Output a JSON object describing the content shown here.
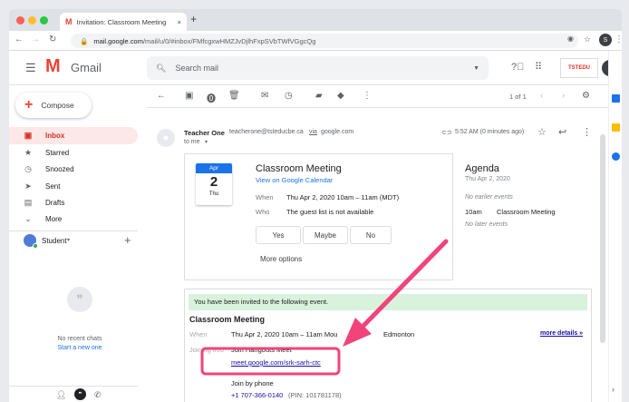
{
  "browser": {
    "tab_title": "Invitation: Classroom Meeting",
    "tab_close": "×",
    "new_tab": "+",
    "url_host": "mail.google.com",
    "url_path": "/mail/u/0/#inbox/FMfcgxwHMZJvDjlhFxpSVbTWfVGgcQg",
    "profile_initial": "S"
  },
  "gmail": {
    "logo_text": "Gmail",
    "search_placeholder": "Search mail",
    "account_initial": "S",
    "org_logo_text": "TSTEDU"
  },
  "sidebar": {
    "compose_label": "Compose",
    "items": [
      {
        "label": "Inbox",
        "icon": "inbox-icon",
        "active": true
      },
      {
        "label": "Starred",
        "icon": "star-icon"
      },
      {
        "label": "Snoozed",
        "icon": "clock-icon"
      },
      {
        "label": "Sent",
        "icon": "send-icon"
      },
      {
        "label": "Drafts",
        "icon": "draft-icon"
      },
      {
        "label": "More",
        "icon": "chevron-down-icon"
      }
    ],
    "user_label": "Student",
    "no_chats": "No recent chats",
    "start_chat": "Start a new one"
  },
  "toolbar": {
    "pagination": "1 of 1"
  },
  "message": {
    "sender_name": "Teacher One",
    "sender_email": "teacherone@tsteducbe.ca",
    "via_text": "via",
    "via_domain": "google.com",
    "to_text": "to me",
    "timestamp": "5:52 AM (0 minutes ago)"
  },
  "event": {
    "cal_month": "Apr",
    "cal_day": "2",
    "cal_weekday": "Thu",
    "title": "Classroom Meeting",
    "view_link": "View on Google Calendar",
    "when_label": "When",
    "when_value": "Thu Apr 2, 2020 10am – 11am (MDT)",
    "who_label": "Who",
    "who_value": "The guest list is not available",
    "rsvp_yes": "Yes",
    "rsvp_maybe": "Maybe",
    "rsvp_no": "No",
    "more_options": "More options"
  },
  "agenda": {
    "title": "Agenda",
    "date": "Thu Apr 2, 2020",
    "no_earlier": "No earlier events",
    "item_time": "10am",
    "item_title": "Classroom Meeting",
    "no_later": "No later events"
  },
  "invite": {
    "banner": "You have been invited to the following event.",
    "title": "Classroom Meeting",
    "when_label": "When",
    "when_value": "Thu Apr 2, 2020 10am – 11am Mou",
    "when_tail": "Edmonton",
    "more_details": "more details »",
    "joining_label": "Joining info",
    "hangouts_label": "Join Hangouts Meet",
    "meet_link": "meet.google.com/srk-sarh-ctc",
    "phone_label": "Join by phone",
    "phone_value": "+1 707-366-0140",
    "pin_value": "(PIN: 101781178)"
  },
  "colors": {
    "accent_red": "#d93025",
    "link_blue": "#1a73e8",
    "annotation_pink": "#f0447a"
  }
}
